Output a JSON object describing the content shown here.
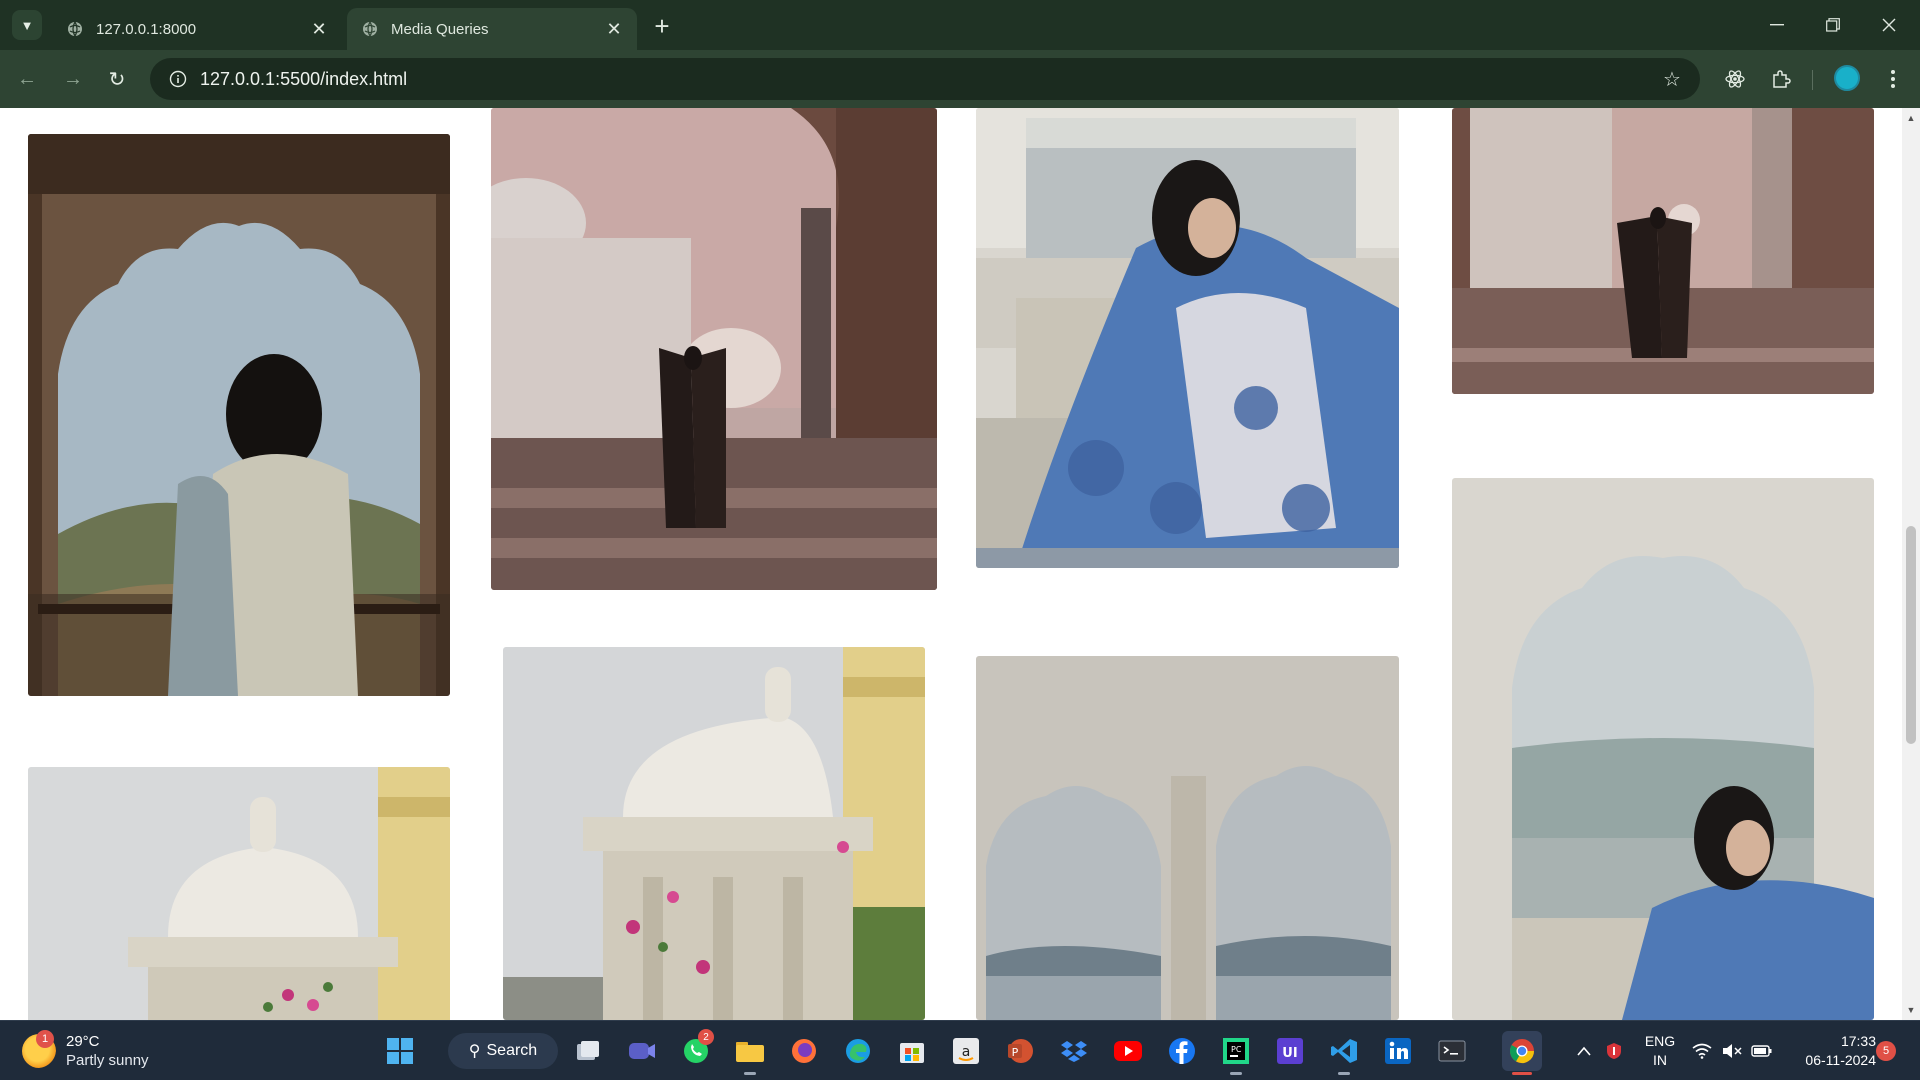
{
  "browser": {
    "tabs": [
      {
        "title": "127.0.0.1:8000",
        "active": false
      },
      {
        "title": "Media Queries",
        "active": true
      }
    ],
    "address": "127.0.0.1:5500/index.html",
    "accent_color": "#1f3224",
    "toolbar_color": "#2e4433"
  },
  "gallery": {
    "photos": [
      {
        "subject": "Woman in scalloped arch overlooking hills",
        "column": 1
      },
      {
        "subject": "Woman with dupatta in front of Taj Mahal at sunset",
        "column": 2
      },
      {
        "subject": "Woman in blue floral dress by lake window",
        "column": 3
      },
      {
        "subject": "Woman with dupatta in front of Taj Mahal",
        "column": 4
      },
      {
        "subject": "White marble domed pavilion with bougainvillea",
        "column": 1
      },
      {
        "subject": "White marble chhatri with pink flowers",
        "column": 2
      },
      {
        "subject": "Scalloped arch windows overlooking lake",
        "column": 3
      },
      {
        "subject": "Woman in blue dress seated in scalloped arch by lake",
        "column": 4
      }
    ]
  },
  "taskbar": {
    "weather": {
      "temperature": "29°C",
      "condition": "Partly sunny",
      "badge": "1"
    },
    "search_label": "Search",
    "apps": [
      "windows-start",
      "task-view",
      "teams",
      "whatsapp",
      "file-explorer",
      "firefox",
      "edge",
      "microsoft-store",
      "amazon",
      "powerpoint",
      "dropbox",
      "youtube",
      "facebook",
      "pycharm",
      "ui-app",
      "vscode",
      "linkedin",
      "terminal",
      "chrome"
    ],
    "whatsapp_badge": "2",
    "language": {
      "line1": "ENG",
      "line2": "IN"
    },
    "clock": {
      "time": "17:33",
      "date": "06-11-2024"
    },
    "notification_count": "5"
  }
}
